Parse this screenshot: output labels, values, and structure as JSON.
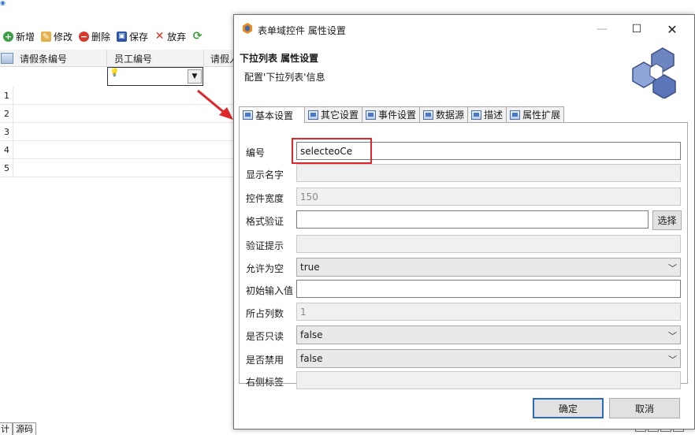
{
  "background": {
    "toolbar": [
      {
        "label": "新增",
        "icon": "add-icon"
      },
      {
        "label": "修改",
        "icon": "edit-icon"
      },
      {
        "label": "删除",
        "icon": "delete-icon"
      },
      {
        "label": "保存",
        "icon": "save-icon"
      },
      {
        "label": "放弃",
        "icon": "discard-icon"
      }
    ],
    "grid": {
      "columns": [
        "请假条编号",
        "员工编号",
        "请假人"
      ],
      "rows": [
        "1",
        "2",
        "3",
        "4",
        "5"
      ]
    },
    "bottom_tabs": [
      "计",
      "源码"
    ]
  },
  "dialog": {
    "title": "表单域控件 属性设置",
    "header_title": "下拉列表 属性设置",
    "header_subtitle": "配置'下拉列表'信息",
    "tabs": [
      "基本设置",
      "其它设置",
      "事件设置",
      "数据源",
      "描述",
      "属性扩展"
    ],
    "active_tab": "基本设置",
    "fields": {
      "id": {
        "label": "编号",
        "value": "selecteoCe"
      },
      "display_name": {
        "label": "显示名字",
        "value": ""
      },
      "width": {
        "label": "控件宽度",
        "value": "150"
      },
      "format": {
        "label": "格式验证",
        "value": "",
        "button": "选择"
      },
      "hint": {
        "label": "验证提示",
        "value": ""
      },
      "nullable": {
        "label": "允许为空",
        "value": "true"
      },
      "initial": {
        "label": "初始输入值",
        "value": ""
      },
      "columns": {
        "label": "所占列数",
        "value": "1"
      },
      "readonly": {
        "label": "是否只读",
        "value": "false"
      },
      "disabled": {
        "label": "是否禁用",
        "value": "false"
      },
      "right_label": {
        "label": "右侧标签",
        "value": ""
      }
    },
    "buttons": {
      "ok": "确定",
      "cancel": "取消"
    }
  },
  "colors": {
    "highlight": "#e0262a",
    "accent": "#2a6cc5",
    "arrow": "#e0262a"
  }
}
